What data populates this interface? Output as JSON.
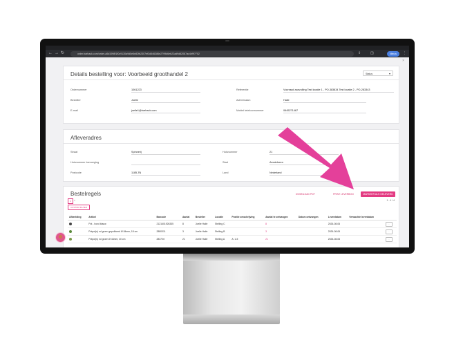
{
  "browser": {
    "url": "order.barhack.com/order-a5d1998f1f0c9130a9d5e5e82fb2307ef3d546386e2799d6eb22ad9d82087ac4b9f?702",
    "profile_label": "Nieuw",
    "nav_icons": [
      "back-icon",
      "forward-icon",
      "reload-icon"
    ]
  },
  "details": {
    "title": "Details bestelling voor: Voorbeeld groothandel 2",
    "status_select": "Status",
    "fields": [
      {
        "label": "Ordernummer",
        "value": "1061223"
      },
      {
        "label": "Referentie",
        "value": "Voorraad aanvulling Test locatie 1 - PO-383834 Test locatie 2 - PO-283343"
      },
      {
        "label": "Besteller",
        "value": "Joelle"
      },
      {
        "label": "Achternaam",
        "value": "Haile"
      },
      {
        "label": "E-mail",
        "value": "joelle1@barhack.com"
      },
      {
        "label": "Mobiel telefoonnummer",
        "value": "0645271467"
      }
    ]
  },
  "delivery": {
    "title": "Afleveradres",
    "fields": [
      {
        "label": "Straat",
        "value": "Spinnerij"
      },
      {
        "label": "Huisnummer",
        "value": "21"
      },
      {
        "label": "Huisnummer toevoeging",
        "value": ""
      },
      {
        "label": "Stad",
        "value": "Amstelveen"
      },
      {
        "label": "Postcode",
        "value": "1185 ZN"
      },
      {
        "label": "Land",
        "value": "Nederland"
      }
    ]
  },
  "order_lines": {
    "title": "Bestelregels",
    "download_pdf": "DOWNLOAD PDF",
    "print_packing_slip": "PRINT LEVERBON",
    "mark_button": "MARKEER ALS GELEVERD",
    "page_current": "1",
    "page_next": "»",
    "range_label": "1 - 4 / 4",
    "filter_button": "CUSTOM FILTER",
    "columns": [
      "Afbeelding",
      "Artikel",
      "Barcode",
      "Aantal",
      "Besteller",
      "Locatie",
      "Positie omschrijving",
      "Aantal te ontvangen",
      "Datum ontvangen",
      "Leverdatum",
      "Verwachte leverdatum"
    ],
    "rows": [
      {
        "artikel": "Pot - hond blauw",
        "barcode": "2121601926335",
        "aantal": "8",
        "besteller": "Joelle Haile",
        "locatie": "Stelling C",
        "positie": "",
        "te_ontvangen": "8",
        "ontvangen": "",
        "leverdatum": "2026-08-06",
        "verwacht": "",
        "thumb_color": "#444444"
      },
      {
        "artikel": "Potpot(s) rol groen gepolitoerd Ø 84mm, 18 cm",
        "barcode": "2880311",
        "aantal": "3",
        "besteller": "Joelle Haile",
        "locatie": "Stelling B",
        "positie": "",
        "te_ontvangen": "3",
        "ontvangen": "",
        "leverdatum": "2026-08-06",
        "verwacht": "",
        "thumb_color": "#5a8a3a"
      },
      {
        "artikel": "Potpot(s) rol groen Ø 44mm, 40 cm",
        "barcode": "28370rt",
        "aantal": "21",
        "besteller": "Joelle Haile",
        "locatie": "Stelling A",
        "positie": "A: 1-5",
        "te_ontvangen": "21",
        "ontvangen": "",
        "leverdatum": "2026-08-06",
        "verwacht": "",
        "thumb_color": "#7a9a4a"
      }
    ]
  },
  "colors": {
    "accent": "#e33b82",
    "arrow": "#e4409a"
  }
}
